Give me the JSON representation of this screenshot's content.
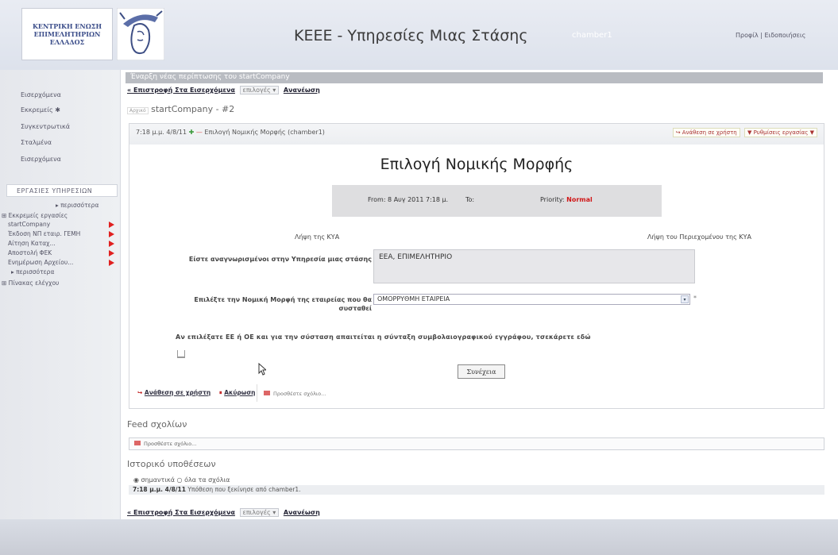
{
  "header": {
    "logo_text": "ΚΕΝΤΡΙΚΗ ΕΝΩΣΗ ΕΠΙΜΕΛΗΤΗΡΙΩΝ ΕΛΛΑΔΟΣ",
    "site_title": "ΚΕΕΕ - Υπηρεσίες Μιας Στάσης",
    "user_name": "chamber1",
    "logout_link": "Προφίλ | Ειδοποιήσεις"
  },
  "sidebar": {
    "items": [
      {
        "label": "Εισερχόμενα"
      },
      {
        "label": "Εκκρεμείς ✱"
      },
      {
        "label": "Συγκεντρωτικά"
      },
      {
        "label": "Σταλμένα"
      },
      {
        "label": "Εισερχόμενα"
      }
    ],
    "section_title": "ΕΡΓΑΣΙΕΣ ΥΠΗΡΕΣΙΩΝ",
    "more_link_1": "▸ περισσότερα",
    "group_title": "⊞ Εκκρεμείς εργασίες",
    "group_items": [
      {
        "label": "startCompany"
      },
      {
        "label": "Έκδοση ΝΠ εταιρ. ΓΕΜΗ"
      },
      {
        "label": "Αίτηση Καταχ..."
      },
      {
        "label": "Αποστολή ΦΕΚ"
      },
      {
        "label": "Ενημέρωση Αρχείου..."
      }
    ],
    "more_link_2": "▸ περισσότερα",
    "group2_title": "⊞ Πίνακας ελέγχου"
  },
  "main": {
    "page_header": "Έναρξη νέας περίπτωσης του startCompany",
    "link_bar": {
      "link1": "« Επιστροφή Στα Εισερχόμενα",
      "dropdown": "επιλογές ▾",
      "link2": "Ανανέωση"
    },
    "breadcrumb_tag": "Αρχικό",
    "breadcrumb": "startCompany - #2",
    "task": {
      "meta_time": "7:18 μ.μ. 4/8/11",
      "meta_plus": "✚",
      "meta_minus": "—",
      "meta_text": "Επιλογή Νομικής Μορφής (chamber1)",
      "action_comment": "↪ Ανάθεση σε χρήστη",
      "action_return": "▼ Ρυθμίσεις εργασίας ▼",
      "form_title": "Επιλογή Νομικής Μορφής",
      "info": {
        "from": "From: 8 Αυγ 2011 7:18 μ.",
        "to": "To:",
        "priority_label": "Priority:",
        "priority_value": "Normal"
      },
      "col_left": "Λήψη της ΚΥΑ",
      "col_right": "Λήψη του Περιεχομένου της ΚΥΑ",
      "services_label": "Είστε αναγνωρισμένοι στην Υπηρεσία μιας στάσης",
      "services_value": "ΕΕΑ, ΕΠΙΜΕΛΗΤΗΡΙΟ",
      "legal_form_label": "Επιλέξτε την Νομική Μορφή της εταιρείας που θα συσταθεί",
      "legal_form_value": "ΟΜΟΡΡΥΘΜΗ ΕΤΑΙΡΕΙΑ",
      "required_mark": "*",
      "note": "Αν επιλέξατε ΕΕ ή ΟΕ και για την σύσταση απαιτείται η σύνταξη συμβολαιογραφικού εγγράφου, τσεκάρετε εδώ",
      "continue_button": "Συνέχεια",
      "bottom_assign": "Ανάθεση σε χρήστη",
      "bottom_cancel": "Ακύρωση",
      "comment_placeholder": "Προσθέστε σχόλιο..."
    },
    "feed_title": "Feed σχολίων",
    "feed_placeholder": "Προσθέστε σχόλιο...",
    "history_title": "Ιστορικό υποθέσεων",
    "history_radios": "◉ σημαντικά  ○ όλα τα σχόλια",
    "history_time": "7:18 μ.μ. 4/8/11",
    "history_text": " Υπόθεση που ξεκίνησε από chamber1.",
    "link_bar_bottom": {
      "link1": "« Επιστροφή Στα Εισερχόμενα",
      "dropdown": "επιλογές ▾",
      "link2": "Ανανέωση"
    }
  }
}
